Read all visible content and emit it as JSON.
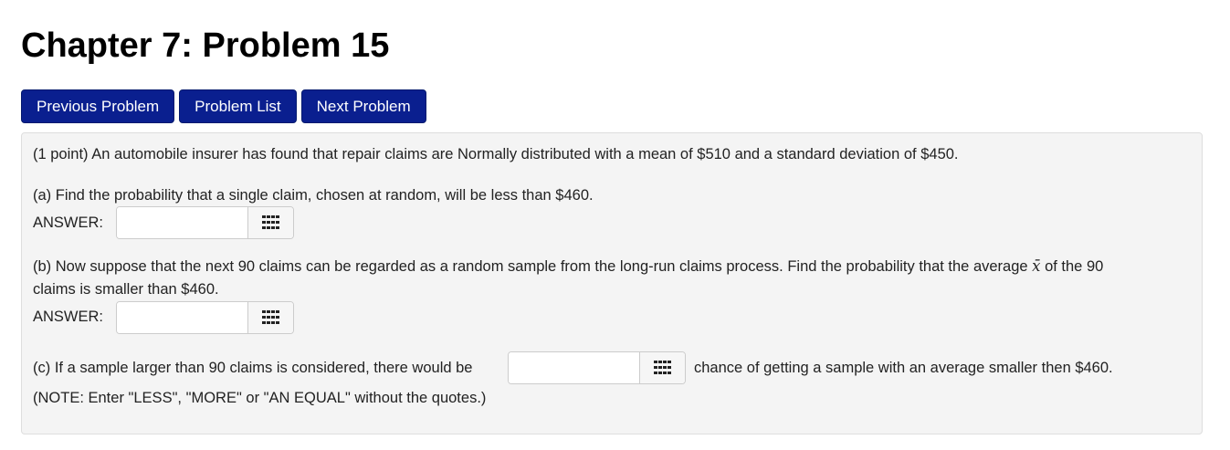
{
  "page": {
    "title": "Chapter 7: Problem 15"
  },
  "nav": {
    "previous_label": "Previous Problem",
    "list_label": "Problem List",
    "next_label": "Next Problem"
  },
  "problem": {
    "intro": "(1 point) An automobile insurer has found that repair claims are Normally distributed with a mean of $510 and a standard deviation of $450.",
    "part_a": {
      "question": "(a) Find the probability that a single claim, chosen at random, will be less than $460.",
      "answer_label": "ANSWER:",
      "answer_value": ""
    },
    "part_b": {
      "question_prefix": "(b) Now suppose that the next 90 claims can be regarded as a random sample from the long-run claims process. Find the probability that the average",
      "math_symbol": "x̄",
      "question_suffix": "of the 90",
      "question_line2": "claims is smaller than $460.",
      "answer_label": "ANSWER:",
      "answer_value": ""
    },
    "part_c": {
      "question_before": "(c) If a sample larger than 90 claims is considered, there would be",
      "question_after": "chance of getting a sample with an average smaller then $460.",
      "answer_value": "",
      "note": "(NOTE: Enter \"LESS\", \"MORE\" or \"AN EQUAL\" without the quotes.)"
    }
  },
  "icons": {
    "palette": "grid-palette-icon"
  }
}
